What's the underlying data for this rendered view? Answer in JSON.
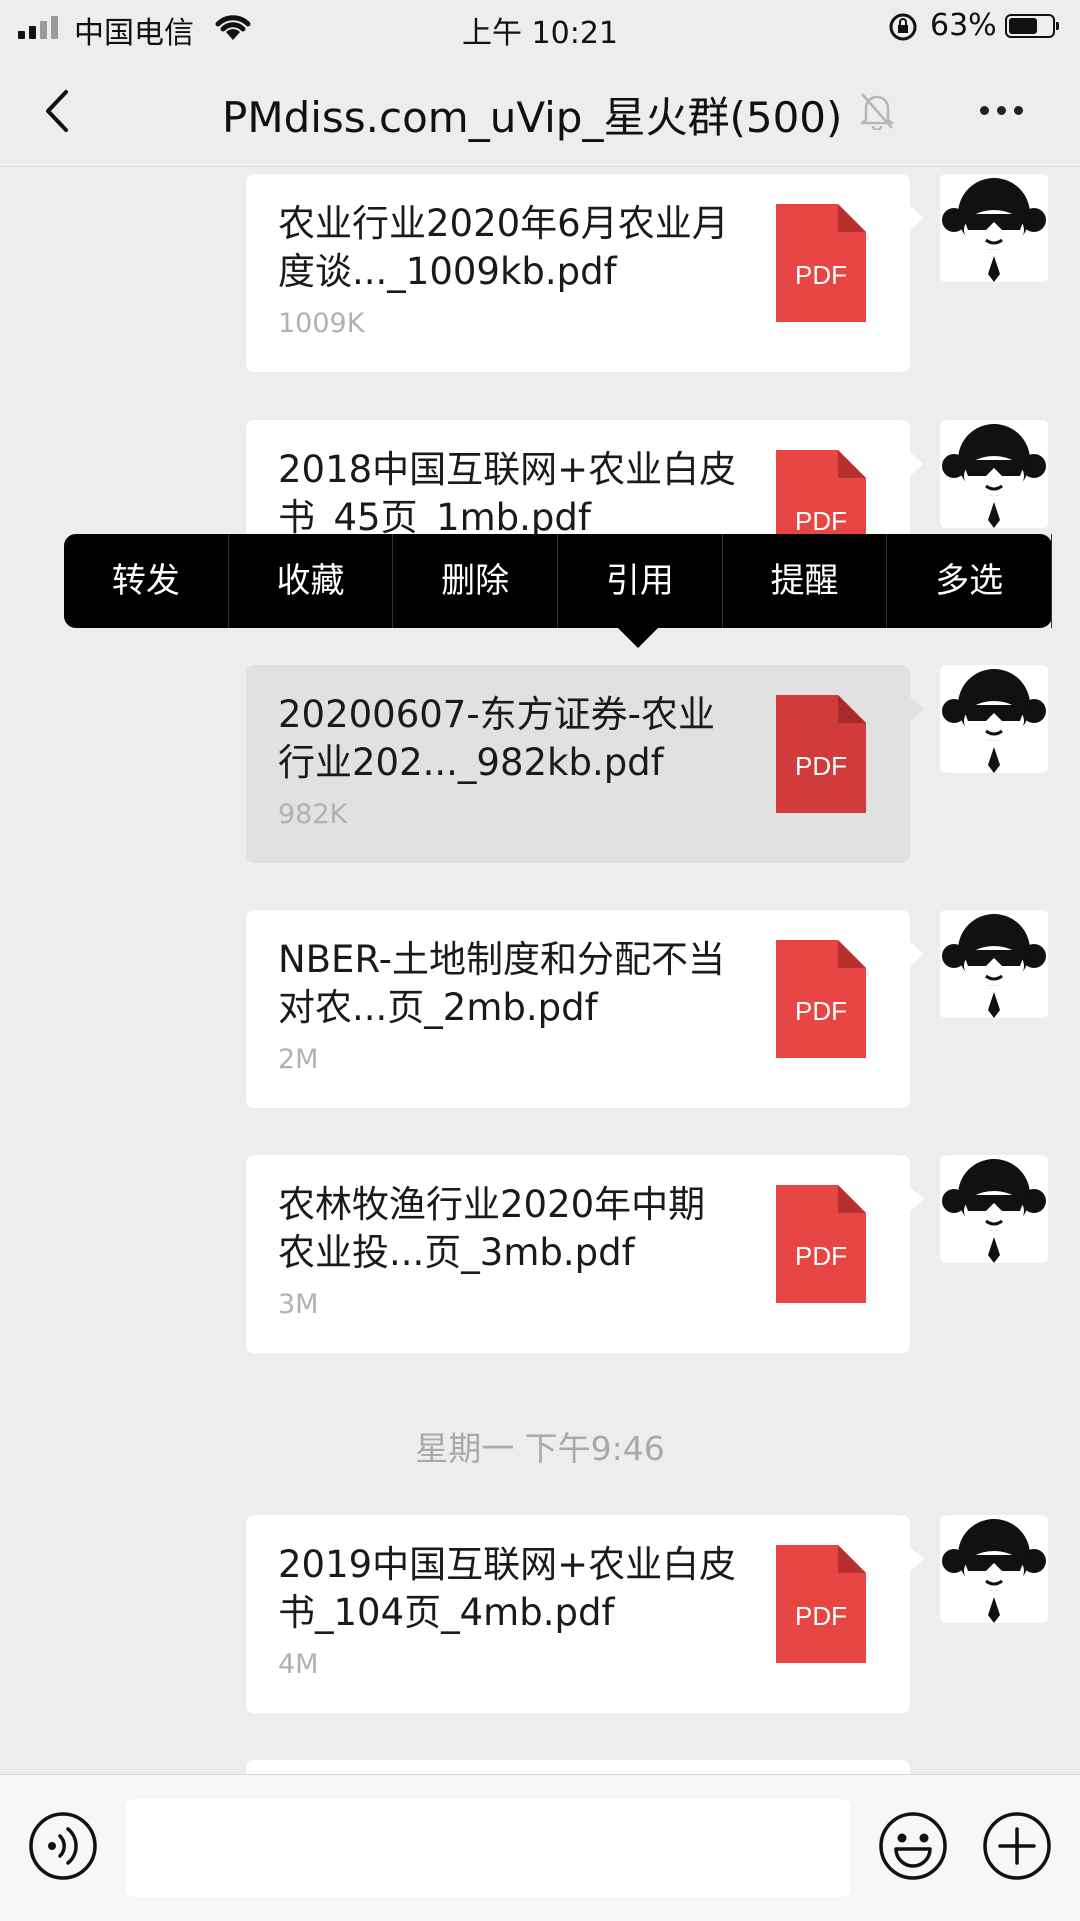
{
  "status_bar": {
    "carrier": "中国电信",
    "time": "上午 10:21",
    "battery": "63%"
  },
  "nav": {
    "title": "PMdiss.com_uVip_星火群(500)"
  },
  "context_menu": [
    "转发",
    "收藏",
    "删除",
    "引用",
    "提醒",
    "多选"
  ],
  "pdf_label": "PDF",
  "messages": [
    {
      "name": "农业行业2020年6月农业月度谈..._1009kb.pdf",
      "size": "1009K"
    },
    {
      "name": "2018中国互联网+农业白皮书_45页_1mb.pdf",
      "size": ""
    },
    {
      "name": "20200607-东方证券-农业行业202..._982kb.pdf",
      "size": "982K"
    },
    {
      "name": "NBER-土地制度和分配不当对农...页_2mb.pdf",
      "size": "2M"
    },
    {
      "name": "农林牧渔行业2020年中期农业投...页_3mb.pdf",
      "size": "3M"
    },
    {
      "name": "2019中国互联网+农业白皮书_104页_4mb.pdf",
      "size": "4M"
    }
  ],
  "timestamp": "星期一 下午9:46",
  "colors": {
    "pdf_red": "#e84545",
    "menu_bg": "#000000",
    "chat_bg": "#ededed"
  }
}
